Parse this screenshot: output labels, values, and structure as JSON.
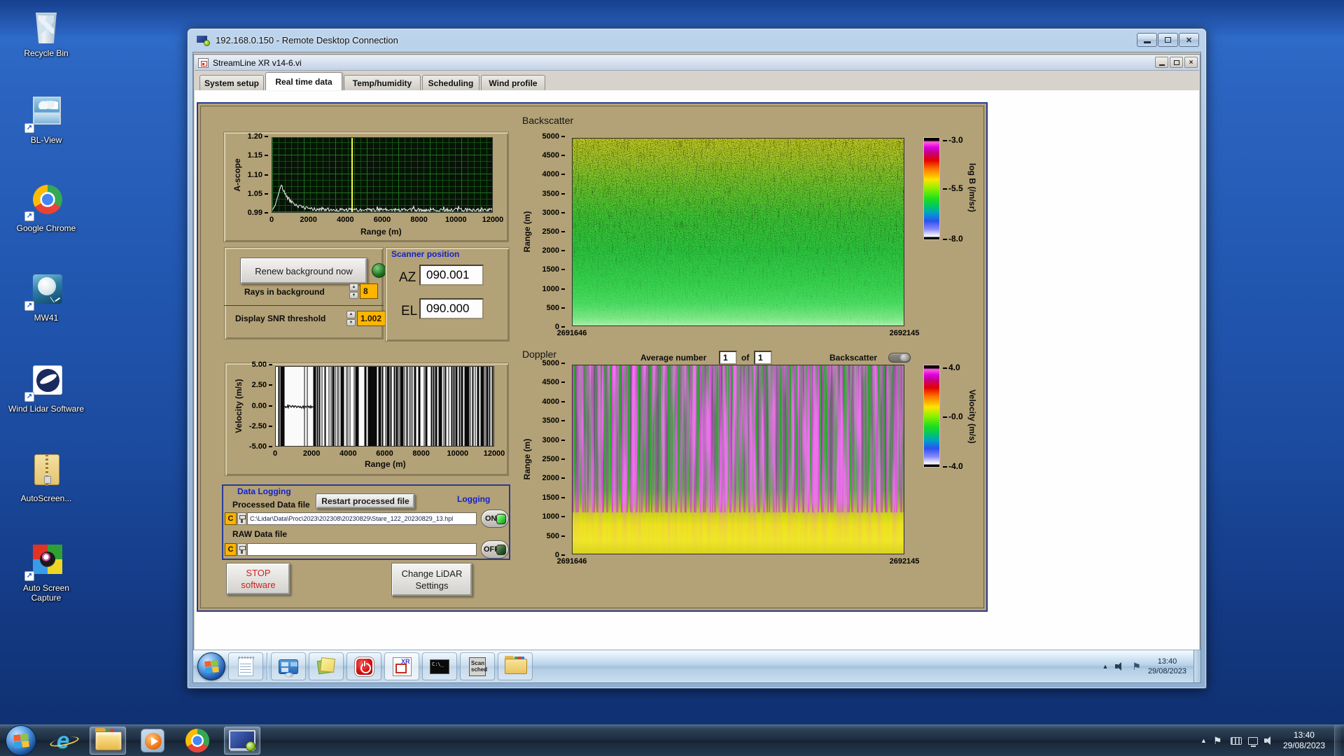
{
  "desktop": {
    "icons": [
      {
        "label": "Recycle Bin"
      },
      {
        "label": "BL-View"
      },
      {
        "label": "Google Chrome"
      },
      {
        "label": "MW41"
      },
      {
        "label": "Wind Lidar Software"
      },
      {
        "label": "AutoScreen..."
      },
      {
        "label": "Auto Screen Capture"
      }
    ]
  },
  "rdp": {
    "title": "192.168.0.150 - Remote Desktop Connection"
  },
  "app": {
    "title": "StreamLine XR v14-6.vi",
    "tabs": [
      {
        "label": "System setup"
      },
      {
        "label": "Real time data"
      },
      {
        "label": "Temp/humidity"
      },
      {
        "label": "Scheduling"
      },
      {
        "label": "Wind profile"
      }
    ],
    "active_tab": "Real time data"
  },
  "panel": {
    "ascope": {
      "ylabel": "A-scope",
      "yticks": [
        "1.20",
        "1.15",
        "1.10",
        "1.05",
        "0.99"
      ],
      "xticks": [
        "0",
        "2000",
        "4000",
        "6000",
        "8000",
        "10000",
        "12000"
      ],
      "xlabel": "Range (m)"
    },
    "background_ctl": {
      "renew_button": "Renew background now",
      "rays_label": "Rays in background",
      "rays_value": "8",
      "snr_label": "Display SNR threshold",
      "snr_value": "1.002"
    },
    "scanner": {
      "title": "Scanner position",
      "az_label": "AZ",
      "az_value": "090.001",
      "el_label": "EL",
      "el_value": "090.000"
    },
    "backscatter": {
      "title": "Backscatter",
      "ylabel": "Range (m)",
      "yticks": [
        "5000",
        "4500",
        "4000",
        "3500",
        "3000",
        "2500",
        "2000",
        "1500",
        "1000",
        "500",
        "0"
      ],
      "x_start": "2691646",
      "x_end": "2692145",
      "colorbar": {
        "ticks": [
          "-3.0",
          "-5.5",
          "-8.0"
        ],
        "label": "log B (/m/sr)"
      }
    },
    "doppler": {
      "title": "Doppler",
      "avg_label": "Average number",
      "avg_value": "1",
      "of_label": "of",
      "of_count": "1",
      "toggle_label": "Backscatter",
      "ylabel": "Range (m)",
      "yticks": [
        "5000",
        "4500",
        "4000",
        "3500",
        "3000",
        "2500",
        "2000",
        "1500",
        "1000",
        "500",
        "0"
      ],
      "x_start": "2691646",
      "x_end": "2692145",
      "colorbar": {
        "ticks": [
          "4.0",
          "-0.0",
          "-4.0"
        ],
        "label": "Velocity (m/s)"
      }
    },
    "velocity": {
      "ylabel": "Velocity (m/s)",
      "yticks": [
        "5.00",
        "2.50",
        "0.00",
        "-2.50",
        "-5.00"
      ],
      "xticks": [
        "0",
        "2000",
        "4000",
        "6000",
        "8000",
        "10000",
        "12000"
      ],
      "xlabel": "Range (m)"
    },
    "logging": {
      "title": "Data Logging",
      "processed_label": "Processed Data file",
      "restart_button": "Restart processed file",
      "logging_label": "Logging",
      "drive_letter": "C",
      "processed_path": "C:\\Lidar\\Data\\Proc\\2023\\202308\\20230829\\Stare_122_20230829_13.hpl",
      "raw_label": "RAW Data file",
      "raw_path": "",
      "on_label": "ON",
      "off_label": "OFF"
    },
    "stop_button_line1": "STOP",
    "stop_button_line2": "software",
    "settings_button_line1": "Change LiDAR",
    "settings_button_line2": "Settings"
  },
  "remote_taskbar": {
    "xr_text": "XR",
    "cmd_text": "C:\\_",
    "scan_line1": "Scan",
    "scan_line2": "sched",
    "time": "13:40",
    "date": "29/08/2023"
  },
  "host_taskbar": {
    "time": "13:40",
    "date": "29/08/2023"
  }
}
